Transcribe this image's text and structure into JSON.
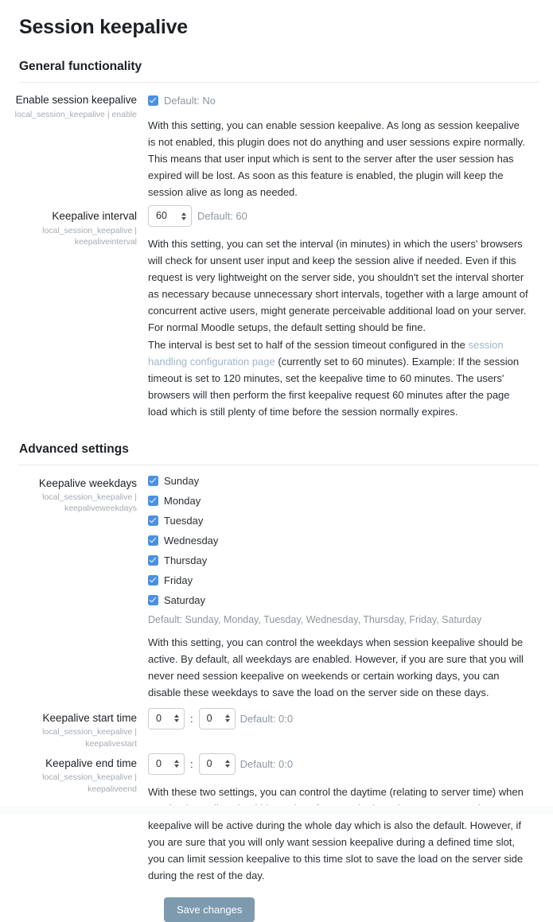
{
  "page": {
    "title": "Session keepalive"
  },
  "colors": {
    "checkbox_blue": "#4a90e2",
    "link_blue": "#9fb6cc",
    "button_slate": "#7e9aaf",
    "muted_text": "#8e979f",
    "identifier_text": "#a4abb2"
  },
  "sections": [
    {
      "heading": "General functionality",
      "settings": [
        {
          "name": "Enable session keepalive",
          "identifier": "local_session_keepalive | enable",
          "control": "checkbox",
          "checked": true,
          "default_label": "Default: No",
          "descriptions": [
            "With this setting, you can enable session keepalive. As long as session keepalive is not enabled, this plugin does not do anything and user sessions expire normally. This means that user input which is sent to the server after the user session has expired will be lost. As soon as this feature is enabled, the plugin will keep the session alive as long as needed."
          ]
        },
        {
          "name": "Keepalive interval",
          "identifier": "local_session_keepalive | keepaliveinterval",
          "control": "number",
          "value": "60",
          "default_label": "Default: 60",
          "descriptions": [
            "With this setting, you can set the interval (in minutes) in which the users' browsers will check for unsent user input and keep the session alive if needed. Even if this request is very lightweight on the server side, you shouldn't set the interval shorter as necessary because unnecessary short intervals, together with a large amount of concurrent active users, might generate perceivable additional load on your server. For normal Moodle setups, the default setting should be fine."
          ],
          "rich_description": {
            "before_link": "The interval is best set to half of the session timeout configured in the ",
            "link_text": "session handling configuration page",
            "after_link": " (currently set to 60 minutes). Example: If the session timeout is set to 120 minutes, set the keepalive time to 60 minutes. The users' browsers will then perform the first keepalive request 60 minutes after the page load which is still plenty of time before the session normally expires."
          }
        }
      ]
    },
    {
      "heading": "Advanced settings",
      "settings": [
        {
          "name": "Keepalive weekdays",
          "identifier": "local_session_keepalive | keepaliveweekdays",
          "control": "checkbox-group",
          "options": [
            {
              "label": "Sunday",
              "checked": true
            },
            {
              "label": "Monday",
              "checked": true
            },
            {
              "label": "Tuesday",
              "checked": true
            },
            {
              "label": "Wednesday",
              "checked": true
            },
            {
              "label": "Thursday",
              "checked": true
            },
            {
              "label": "Friday",
              "checked": true
            },
            {
              "label": "Saturday",
              "checked": true
            }
          ],
          "default_label": "Default: Sunday, Monday, Tuesday, Wednesday, Thursday, Friday, Saturday",
          "descriptions": [
            "With this setting, you can control the weekdays when session keepalive should be active. By default, all weekdays are enabled. However, if you are sure that you will never need session keepalive on weekends or certain working days, you can disable these weekdays to save the load on the server side on these days."
          ]
        },
        {
          "name": "Keepalive start time",
          "identifier": "local_session_keepalive | keepalivestart",
          "control": "time",
          "hours": "0",
          "minutes": "0",
          "separator": ":",
          "default_label": "Default: 0:0"
        },
        {
          "name": "Keepalive end time",
          "identifier": "local_session_keepalive | keepaliveend",
          "control": "time",
          "hours": "0",
          "minutes": "0",
          "separator": ":",
          "default_label": "Default: 0:0",
          "descriptions": [
            "With these two settings, you can control the daytime (relating to server time) when session keepalive should be active. If you set both settings to 0:00, session keepalive will be active during the whole day which is also the default. However, if you are sure that you will only want session keepalive during a defined time slot, you can limit session keepalive to this time slot to save the load on the server side during the rest of the day."
          ]
        }
      ]
    }
  ],
  "footer": {
    "save_label": "Save changes"
  }
}
